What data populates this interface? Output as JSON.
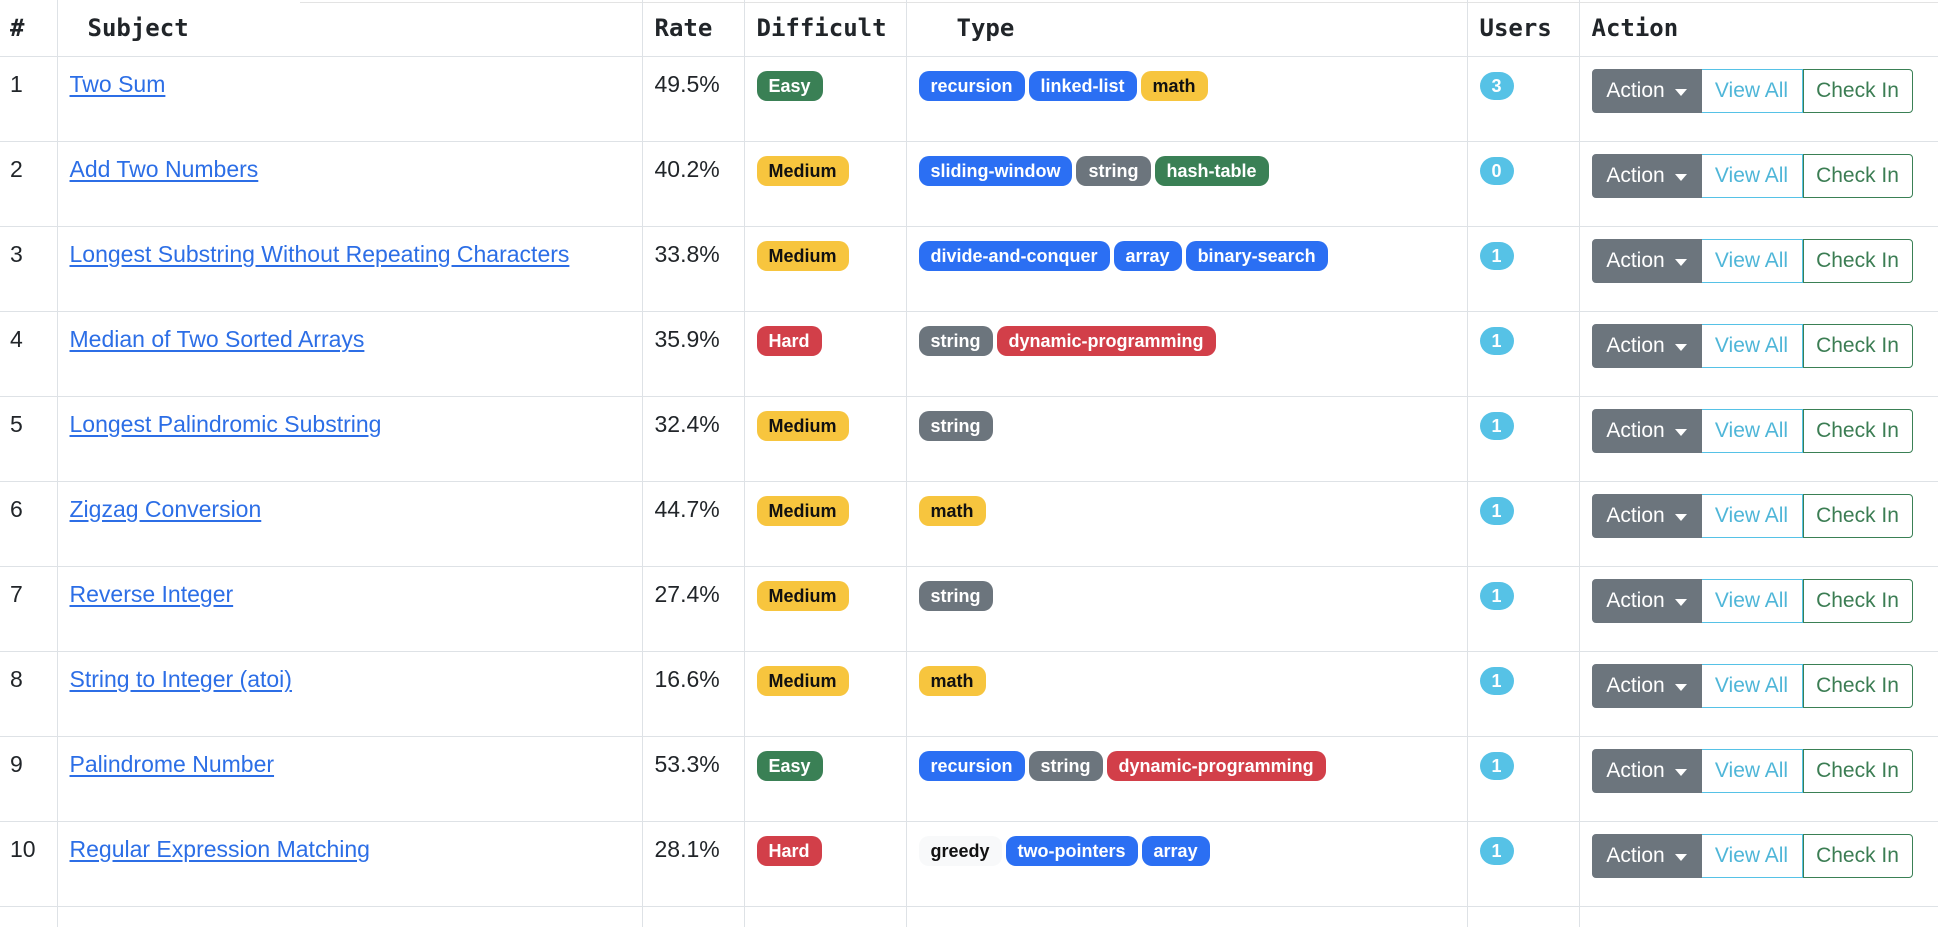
{
  "headers": {
    "num": "#",
    "subject": "Subject",
    "rate": "Rate",
    "difficulty": "Difficult",
    "type": "Type",
    "users": "Users",
    "action": "Action"
  },
  "buttons": {
    "action": "Action",
    "view_all": "View All",
    "check_in": "Check In"
  },
  "colors": {
    "primary": "#2b6ff3",
    "secondary": "#6c757d",
    "success": "#3a8055",
    "warning": "#f7c53e",
    "danger": "#d23f49",
    "info": "#56c2e6",
    "link": "#2c6ee6"
  },
  "rows": [
    {
      "num": "1",
      "subject": "Two Sum",
      "rate": "49.5%",
      "difficulty": {
        "label": "Easy",
        "variant": "success"
      },
      "tags": [
        {
          "label": "recursion",
          "variant": "primary"
        },
        {
          "label": "linked-list",
          "variant": "primary"
        },
        {
          "label": "math",
          "variant": "warning"
        }
      ],
      "users": "3"
    },
    {
      "num": "2",
      "subject": "Add Two Numbers",
      "rate": "40.2%",
      "difficulty": {
        "label": "Medium",
        "variant": "warning"
      },
      "tags": [
        {
          "label": "sliding-window",
          "variant": "primary"
        },
        {
          "label": "string",
          "variant": "secondary"
        },
        {
          "label": "hash-table",
          "variant": "success"
        }
      ],
      "users": "0"
    },
    {
      "num": "3",
      "subject": "Longest Substring Without Repeating Characters",
      "rate": "33.8%",
      "difficulty": {
        "label": "Medium",
        "variant": "warning"
      },
      "tags": [
        {
          "label": "divide-and-conquer",
          "variant": "primary"
        },
        {
          "label": "array",
          "variant": "primary"
        },
        {
          "label": "binary-search",
          "variant": "primary"
        }
      ],
      "users": "1"
    },
    {
      "num": "4",
      "subject": "Median of Two Sorted Arrays",
      "rate": "35.9%",
      "difficulty": {
        "label": "Hard",
        "variant": "danger"
      },
      "tags": [
        {
          "label": "string",
          "variant": "secondary"
        },
        {
          "label": "dynamic-programming",
          "variant": "danger"
        }
      ],
      "users": "1"
    },
    {
      "num": "5",
      "subject": "Longest Palindromic Substring",
      "rate": "32.4%",
      "difficulty": {
        "label": "Medium",
        "variant": "warning"
      },
      "tags": [
        {
          "label": "string",
          "variant": "secondary"
        }
      ],
      "users": "1"
    },
    {
      "num": "6",
      "subject": "Zigzag Conversion",
      "rate": "44.7%",
      "difficulty": {
        "label": "Medium",
        "variant": "warning"
      },
      "tags": [
        {
          "label": "math",
          "variant": "warning"
        }
      ],
      "users": "1"
    },
    {
      "num": "7",
      "subject": "Reverse Integer",
      "rate": "27.4%",
      "difficulty": {
        "label": "Medium",
        "variant": "warning"
      },
      "tags": [
        {
          "label": "string",
          "variant": "secondary"
        }
      ],
      "users": "1"
    },
    {
      "num": "8",
      "subject": "String to Integer (atoi)",
      "rate": "16.6%",
      "difficulty": {
        "label": "Medium",
        "variant": "warning"
      },
      "tags": [
        {
          "label": "math",
          "variant": "warning"
        }
      ],
      "users": "1"
    },
    {
      "num": "9",
      "subject": "Palindrome Number",
      "rate": "53.3%",
      "difficulty": {
        "label": "Easy",
        "variant": "success"
      },
      "tags": [
        {
          "label": "recursion",
          "variant": "primary"
        },
        {
          "label": "string",
          "variant": "secondary"
        },
        {
          "label": "dynamic-programming",
          "variant": "danger"
        }
      ],
      "users": "1"
    },
    {
      "num": "10",
      "subject": "Regular Expression Matching",
      "rate": "28.1%",
      "difficulty": {
        "label": "Hard",
        "variant": "danger"
      },
      "tags": [
        {
          "label": "greedy",
          "variant": "light"
        },
        {
          "label": "two-pointers",
          "variant": "primary"
        },
        {
          "label": "array",
          "variant": "primary"
        }
      ],
      "users": "1"
    }
  ]
}
